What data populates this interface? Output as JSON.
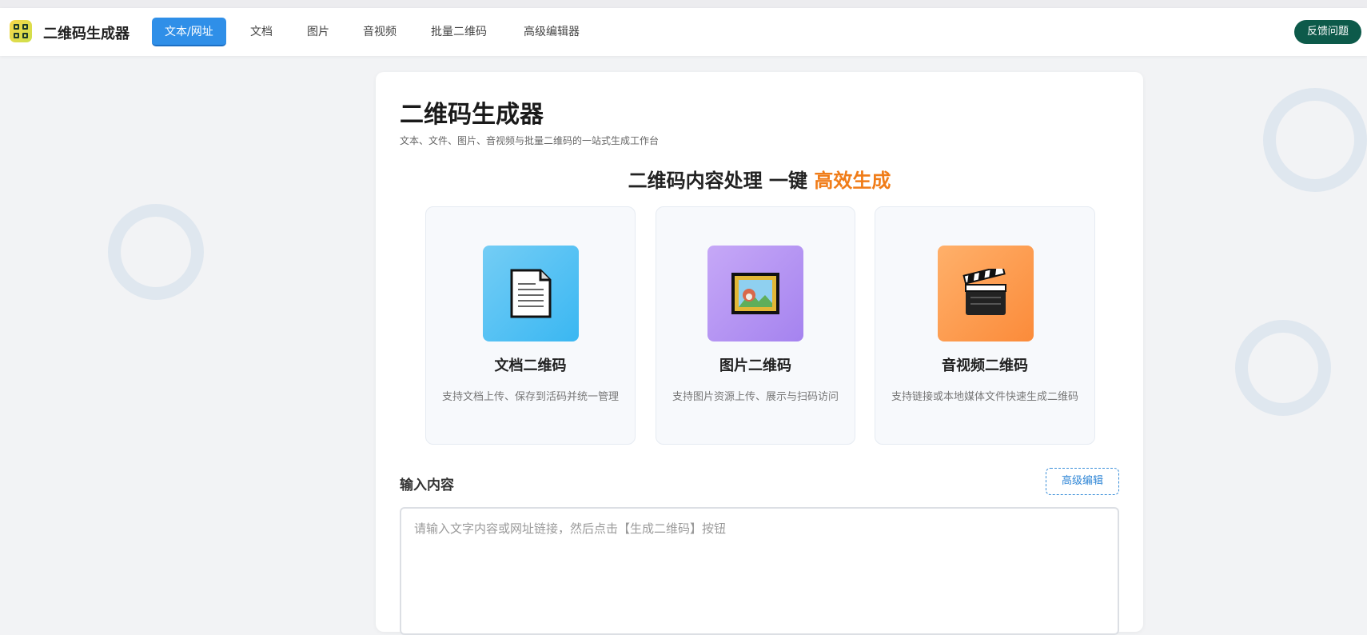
{
  "app": {
    "brand": "二维码生成器",
    "logo_icon": "qr-logo-icon"
  },
  "nav": {
    "items": [
      {
        "label": "文本/网址",
        "active": true
      },
      {
        "label": "文档",
        "active": false
      },
      {
        "label": "图片",
        "active": false
      },
      {
        "label": "音视频",
        "active": false
      },
      {
        "label": "批量二维码",
        "active": false
      },
      {
        "label": "高级编辑器",
        "active": false
      }
    ],
    "feedback_label": "反馈问题"
  },
  "main": {
    "title": "二维码生成器",
    "subtitle": "文本、文件、图片、音视频与批量二维码的一站式生成工作台",
    "slogan_main": "二维码内容处理 一键 ",
    "slogan_highlight": "高效生成",
    "features": [
      {
        "title": "文档二维码",
        "desc": "支持文档上传、保存到活码并统一管理",
        "icon": "document-icon"
      },
      {
        "title": "图片二维码",
        "desc": "支持图片资源上传、展示与扫码访问",
        "icon": "framed-picture-icon"
      },
      {
        "title": "音视频二维码",
        "desc": "支持链接或本地媒体文件快速生成二维码",
        "icon": "clapper-board-icon"
      }
    ],
    "input_label": "输入内容",
    "advanced_edit_label": "高级编辑",
    "input_placeholder": "请输入文字内容或网址链接，然后点击【生成二维码】按钮",
    "input_value": ""
  },
  "colors": {
    "accent": "#2f8fe8",
    "highlight": "#f07c18",
    "feedback_bg": "#0d5a4a"
  }
}
